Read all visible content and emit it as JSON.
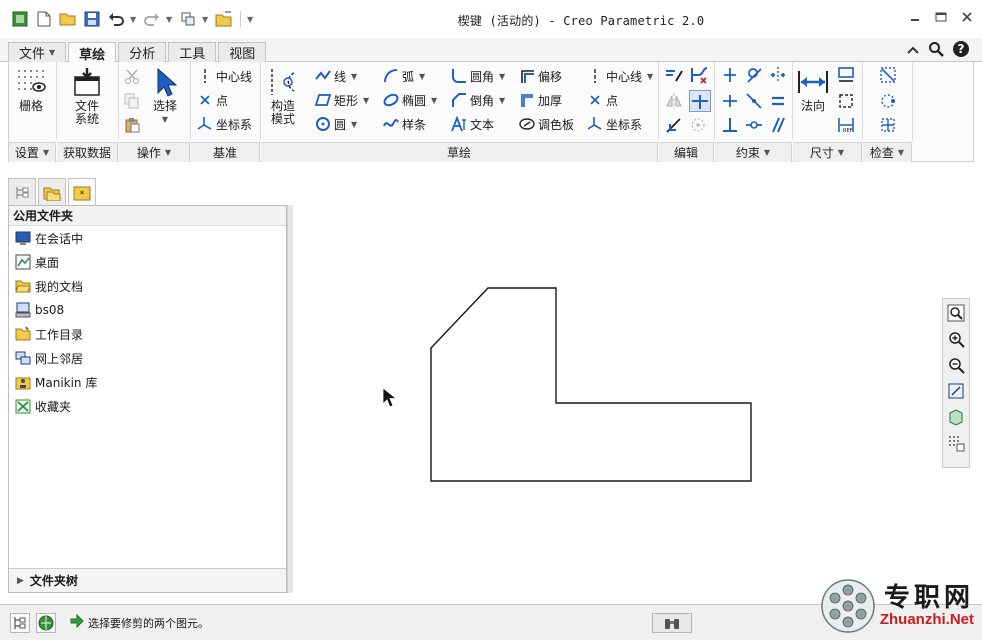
{
  "window": {
    "title": "楔键 (活动的) - Creo Parametric 2.0"
  },
  "tabs": [
    {
      "label": "文件",
      "caret": "▼"
    },
    {
      "label": "草绘"
    },
    {
      "label": "分析"
    },
    {
      "label": "工具"
    },
    {
      "label": "视图"
    }
  ],
  "ribbon": {
    "grid": "栅格",
    "file_system": "文件\n系统",
    "select": "选择",
    "centerline1": "中心线",
    "point1": "点",
    "csys1": "坐标系",
    "construction": "构造\n模式",
    "line": "线",
    "arc": "弧",
    "fillet": "圆角",
    "offset": "偏移",
    "centerline2": "中心线",
    "rectangle": "矩形",
    "ellipse": "椭圆",
    "chamfer": "倒角",
    "thicken": "加厚",
    "point2": "点",
    "circle": "圆",
    "spline": "样条",
    "text": "文本",
    "palette": "调色板",
    "csys2": "坐标系",
    "normal": "法向"
  },
  "groups": {
    "setup": "设置",
    "get_data": "获取数据",
    "operations": "操作",
    "datum": "基准",
    "sketching": "草绘",
    "editing": "编辑",
    "constrain": "约束",
    "dimension": "尺寸",
    "inspect": "检查"
  },
  "navigator": {
    "header": "公用文件夹",
    "folders": [
      "在会话中",
      "桌面",
      "我的文档",
      "bs08",
      "工作目录",
      "网上邻居",
      "Manikin 库",
      "收藏夹"
    ],
    "tree": "文件夹树"
  },
  "status": {
    "message": "选择要修剪的两个图元。"
  },
  "watermark": {
    "cn": "专职网",
    "en": "Zhuanzhi.Net"
  },
  "colors": {
    "sketch": "#1a1a1a",
    "accent": "#1f5fbf",
    "watermark_red": "#c81e1e"
  }
}
